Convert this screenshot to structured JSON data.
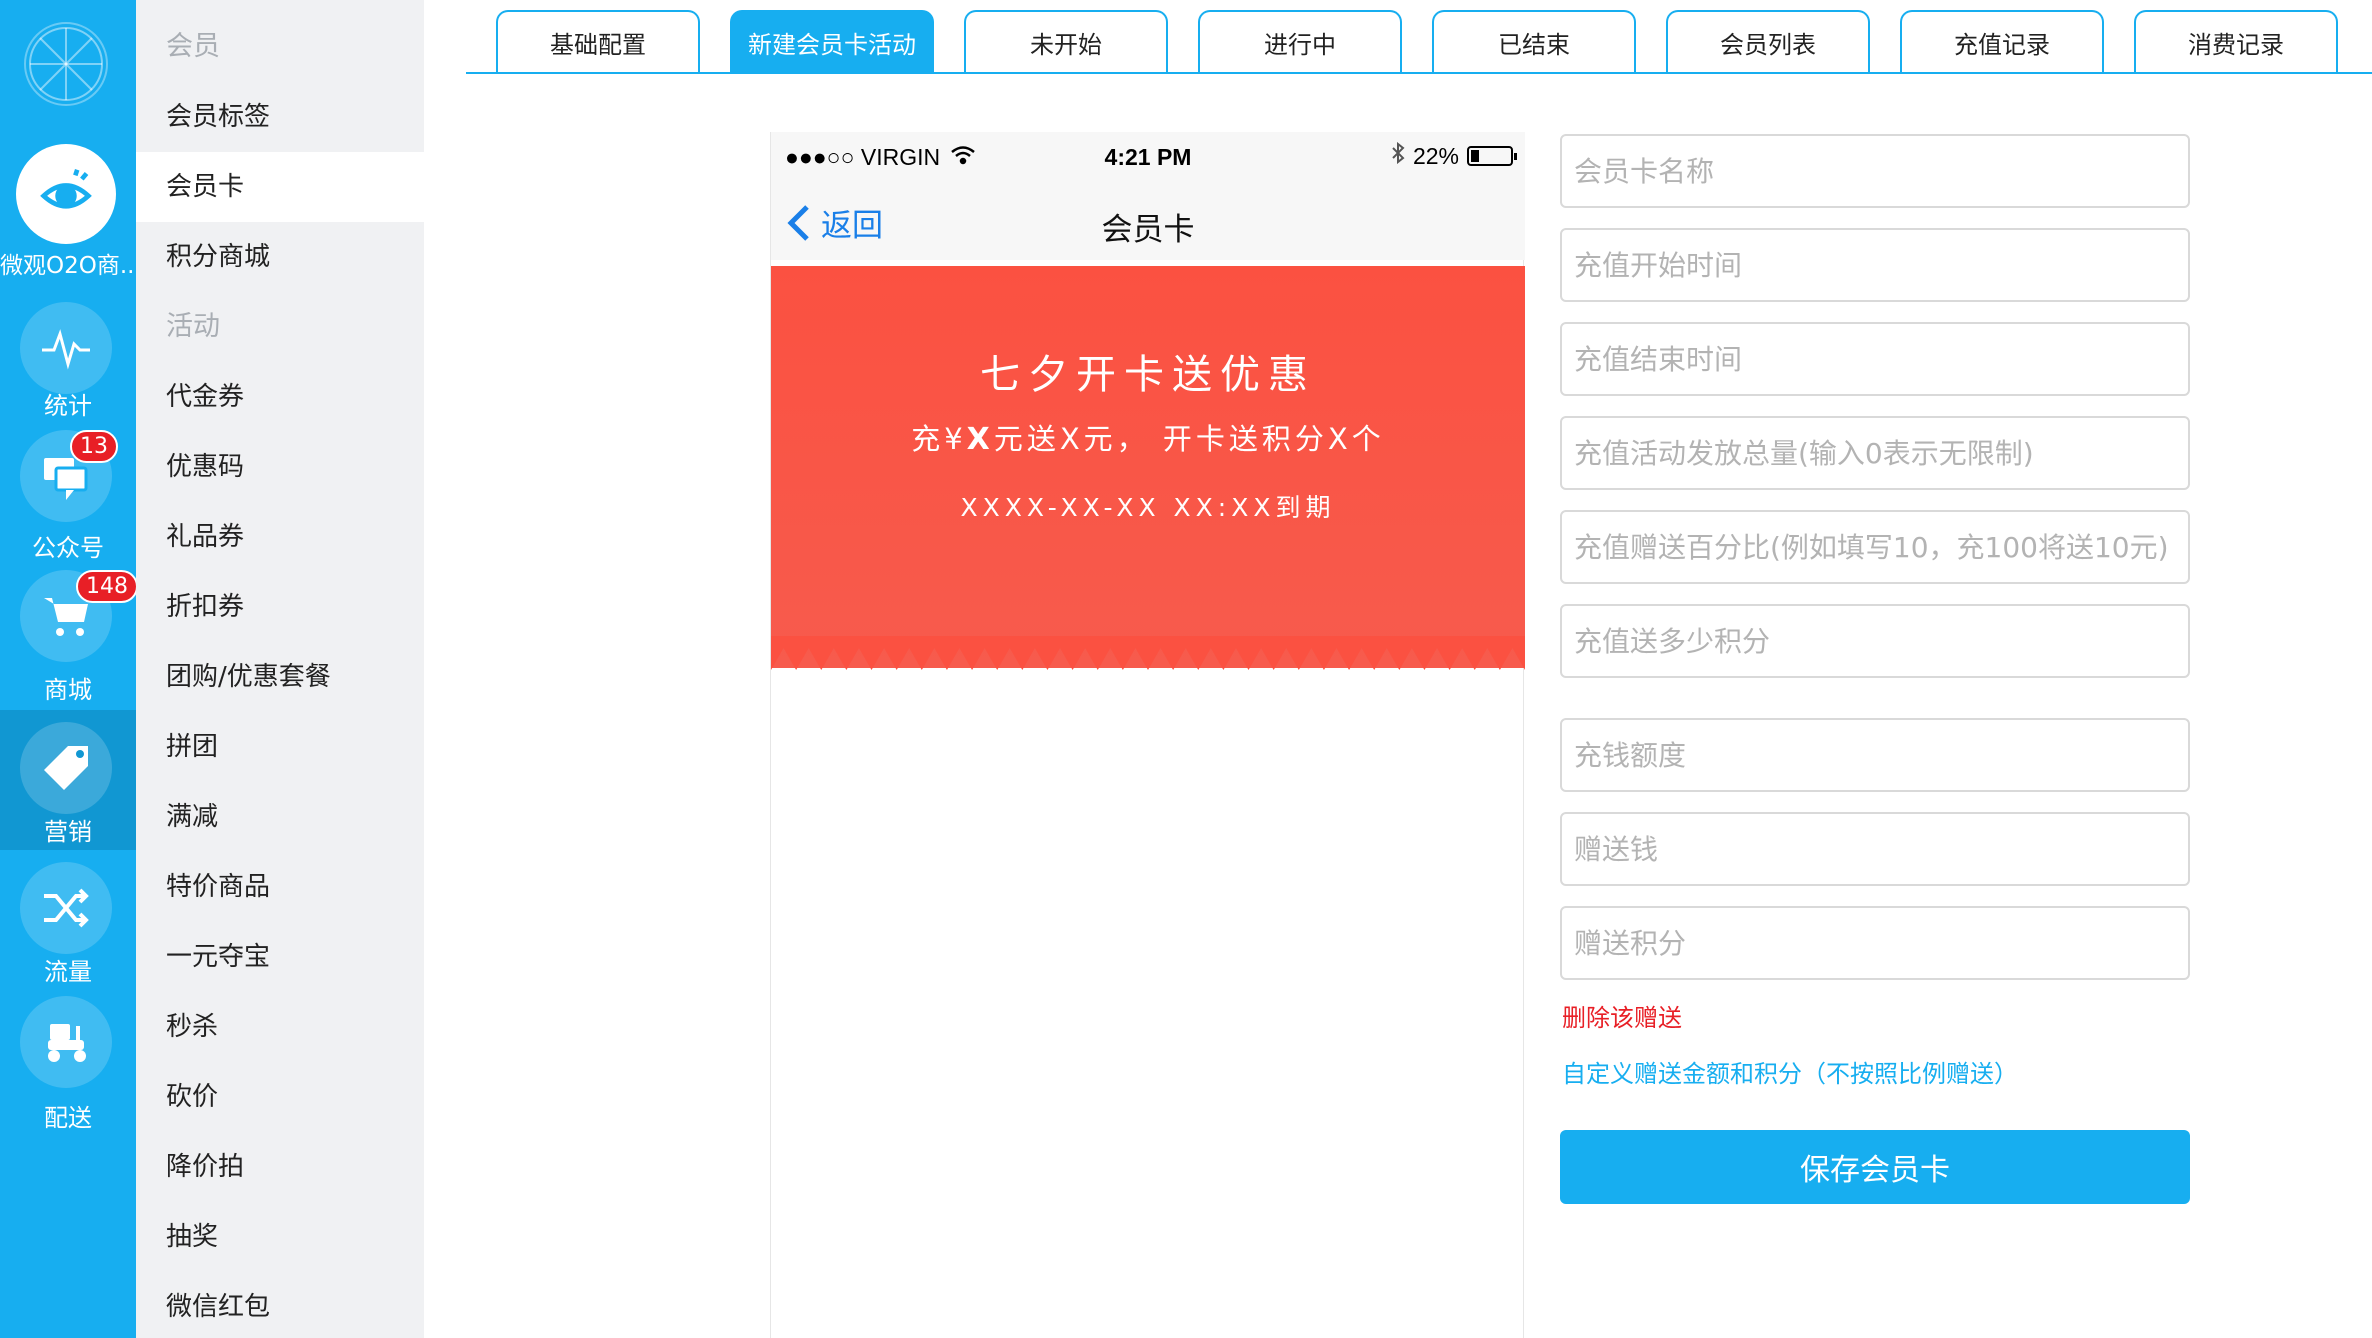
{
  "rail": {
    "app_label": "微观O2O商...",
    "items": [
      {
        "label": "统计",
        "icon": "pulse-icon"
      },
      {
        "label": "公众号",
        "icon": "chat-icon",
        "badge": "13"
      },
      {
        "label": "商城",
        "icon": "cart-icon",
        "badge": "148"
      },
      {
        "label": "营销",
        "icon": "tag-icon"
      },
      {
        "label": "流量",
        "icon": "shuffle-icon"
      },
      {
        "label": "配送",
        "icon": "scooter-icon"
      }
    ]
  },
  "submenu": {
    "section_member": "会员",
    "member_tag": "会员标签",
    "member_card": "会员卡",
    "points_mall": "积分商城",
    "section_activity": "活动",
    "items": [
      "代金券",
      "优惠码",
      "礼品券",
      "折扣券",
      "团购/优惠套餐",
      "拼团",
      "满减",
      "特价商品",
      "一元夺宝",
      "秒杀",
      "砍价",
      "降价拍",
      "抽奖",
      "微信红包"
    ]
  },
  "tabs": [
    "基础配置",
    "新建会员卡活动",
    "未开始",
    "进行中",
    "已结束",
    "会员列表",
    "充值记录",
    "消费记录"
  ],
  "phone": {
    "carrier": "●●●○○ VIRGIN",
    "time": "4:21 PM",
    "battery": "22%",
    "battery_level": 0.22,
    "back": "返回",
    "title": "会员卡",
    "card_title": "七夕开卡送优惠",
    "card_sub_pre": "充¥",
    "card_sub_x": "X",
    "card_sub_post": "元送X元， 开卡送积分X个",
    "card_date": "XXXX-XX-XX XX:XX到期",
    "card_color": "#fb5141"
  },
  "form": {
    "fields": [
      "会员卡名称",
      "充值开始时间",
      "充值结束时间",
      "充值活动发放总量(输入0表示无限制)",
      "充值赠送百分比(例如填写10，充100将送10元)",
      "充值送多少积分",
      "充钱额度",
      "赠送钱",
      "赠送积分"
    ],
    "delete_link": "删除该赠送",
    "custom_link": "自定义赠送金额和积分（不按照比例赠送）",
    "save": "保存会员卡"
  },
  "colors": {
    "accent": "#17aef0",
    "danger": "#e81f26",
    "link": "#1a7fe8"
  }
}
